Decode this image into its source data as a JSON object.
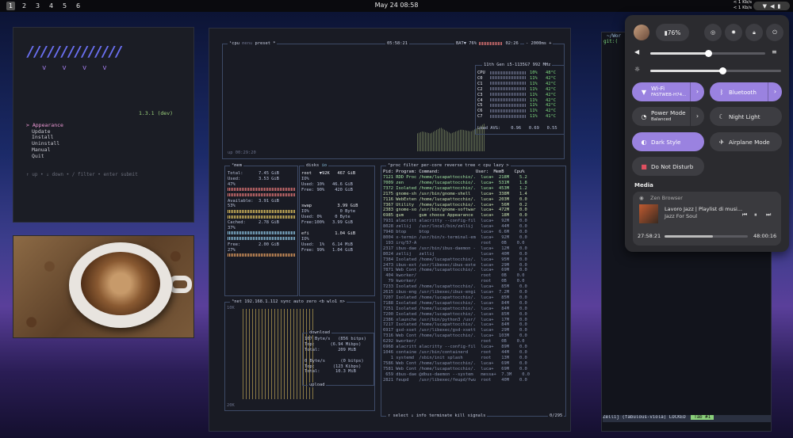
{
  "topbar": {
    "workspaces": [
      "1",
      "2",
      "3",
      "4",
      "5",
      "6"
    ],
    "clock": "May 24  08:58",
    "net_up": "< 1 Kb/s",
    "net_down": "< 1 Kb/s"
  },
  "gum": {
    "version": "1.3.1 (dev)",
    "menu": [
      "> Appearance",
      "Update",
      "Install",
      "Uninstall",
      "Manual",
      "Quit"
    ],
    "help": "↑ up • ↓ down • / filter • enter submit"
  },
  "btop": {
    "cpu_title": "cpu",
    "menu": "menu",
    "preset": "preset *",
    "time": "05:58:21",
    "battery": "BAT▼ 76%",
    "bat_time": "02:26",
    "interval": "- 2000ms +",
    "cpu_model": "11th Gen i5-1135G7",
    "freq": "992 MHz",
    "cores": [
      {
        "n": "CPU",
        "p": "10%",
        "t": "48°C"
      },
      {
        "n": "C0",
        "p": "11%",
        "t": "42°C"
      },
      {
        "n": "C1",
        "p": "11%",
        "t": "42°C"
      },
      {
        "n": "C2",
        "p": "11%",
        "t": "42°C"
      },
      {
        "n": "C3",
        "p": "11%",
        "t": "42°C"
      },
      {
        "n": "C4",
        "p": "11%",
        "t": "42°C"
      },
      {
        "n": "C5",
        "p": "11%",
        "t": "42°C"
      },
      {
        "n": "C6",
        "p": "11%",
        "t": "42°C"
      },
      {
        "n": "C7",
        "p": "11%",
        "t": "41°C"
      }
    ],
    "load": "Load AVG:    0.96   0.69   0.55",
    "uptime": "up 00:29:20",
    "mem": {
      "total": "7.45 GiB",
      "used": "3.53 GiB",
      "used_p": "47%",
      "available": "3.91 GiB",
      "avail_p": "53%",
      "cached": "2.78 GiB",
      "cached_p": "37%",
      "free": "2.00 GiB",
      "free_p": "27%"
    },
    "disks": {
      "root_hdr": "root   ▼92K   467 GiB",
      "root_io": "IO%",
      "root_used": "Used: 10%   46.6 GiB",
      "root_free": "Free: 90%    420 GiB",
      "swap_hdr": "swap          3.99 GiB",
      "swap_io": "IO%            0 Byte",
      "swap_used": "Used: 0%     0 Byte",
      "swap_free": "Free:100%   3.99 GiB",
      "efi_hdr": "efi          1.04 GiB",
      "efi_io": "IO%",
      "efi_used": "Used:  1%   6.14 MiB",
      "efi_free": "Free: 99%   1.04 GiB"
    },
    "net": {
      "title": "net",
      "ip": "192.168.1.112",
      "sync": "sync",
      "auto": "auto",
      "zero": "zero",
      "iface": "<b wlo1 n>",
      "scale_top": "10K",
      "scale_bot": "20K",
      "download": "download",
      "dl_rate": "107 Byte/s   (856 bitps)",
      "dl_top": "Top:      (6.94 Mibps)",
      "dl_total": "Total:       209 MiB",
      "ul_rate": "0 Byte/s      (0 bitps)",
      "ul_top": "Top:       (123 Kibps)",
      "ul_total": "Total:      10.3 MiB",
      "upload": "upload"
    },
    "proc": {
      "title": "proc",
      "filter": "filter",
      "per_core": "per-core",
      "reverse": "reverse",
      "tree": "tree",
      "sort": "< cpu lazy >",
      "header": "Pid: Program: Command:              User:  MemB    Cpu%",
      "rows": [
        "7121 RDD Proc /home/lucapattocchio/.  luca+  218M    5.2",
        "7009 zen      /home/lucapattocchio/.  luca+  531M    1.8",
        "7372 Isolated /home/lucapattocchio/.  luca+  453M    1.2",
        "2175 gnome-sh /usr/bin/gnome-shell    luca+  338M    1.4",
        "7116 WebExten /home/lucapattocchio/.  luca+  203M    0.0",
        "7367 Utility  /home/lucapattocchio/.  luca+   56M    0.2",
        "2383 gnome-so /usr/bin/gnome-softwar  luca+  472M    0.0",
        "6985 gum      gum choose Appearance   luca+   18M    0.0",
        "7931 alacritt alacritty --config-fil  luca+   92M    0.0",
        "8028 zellij   /usr/local/bin/zellij   luca+   44M    0.0",
        "7948 btop     btop                    luca+  6.6M    0.0",
        "8004 x-termin /usr/bin/x-terminal-em  luca+   92M    0.0",
        " 193 irq/57-A                         root    0B    0.0",
        "2317 ibus-dae /usr/bin/ibus-daemon -  luca+   12M    0.0",
        "8024 zellij   zellij                  luca+   40M    0.0",
        "7384 Isolated /home/lucapattocchio/.  luca+   95M    0.0",
        "2473 ibus-ext /usr/libexec/ibus-exte  luca+   29M    0.0",
        "7871 Web Cont /home/lucapattocchio/.  luca+   69M    0.0",
        " 404 kworker/                         root    0B    0.0",
        "  79 kworker/                         root    0B    0.0",
        "7233 Isolated /home/lucapattocchio/.  luca+   85M    0.0",
        "2615 ibus-eng /usr/libexec/ibus-engi  luca+  7.2M    0.0",
        "7207 Isolated /home/lucapattocchio/.  luca+   85M    0.0",
        "7188 Isolated /home/lucapattocchio/.  luca+   84M    0.0",
        "7251 Isolated /home/lucapattocchio/.  luca+   84M    0.0",
        "7200 Isolated /home/lucapattocchio/.  luca+   85M    0.0",
        "2386 xlaunche /usr/bin/python3 /usr/  luca+   17M    0.0",
        "7217 Isolated /home/lucapattocchio/.  luca+   84M    0.0",
        "6917 gsd-xset /usr/libexec/gsd-xsett  luca+   29M    0.0",
        "7316 Web Cont /home/lucapattocchio/.  luca+  103M    0.0",
        "6292 kworker/                         root    0B    0.0",
        "6968 alacritt alacritty --config-fil  luca+   89M    0.0",
        "1046 containe /usr/bin/containerd     root    44M    0.0",
        "   1 systemd  /sbin/init splash       root    13M    0.0",
        "7586 Web Cont /home/lucapattocchio/.  luca+   69M    0.0",
        "7581 Web Cont /home/lucapattocchio/.  luca+   69M    0.0",
        " 659 dbus-dae @dbus-daemon --system   messa+  7.3M    0.0",
        "2821 feupd    /usr/libexec/feupd/fwu  root    40M    0.0"
      ],
      "footer": "↑ select ↓  info   terminate  kill   signals",
      "count": "0/295"
    }
  },
  "terminal": {
    "path": "~/Wor",
    "git": "git:(",
    "status": "Zellij (fabulous-viola)  LOCKED",
    "tab": "Tab #1"
  },
  "qs": {
    "battery": "76%",
    "wifi": "Wi-Fi",
    "wifi_sub": "FASTWEB-H74...",
    "bluetooth": "Bluetooth",
    "power": "Power Mode",
    "power_sub": "Balanced",
    "night": "Night Light",
    "dark": "Dark Style",
    "airplane": "Airplane Mode",
    "dnd": "Do Not Disturb",
    "media_label": "Media",
    "browser": "Zen Browser",
    "track": "Lavoro Jazz | Playlist di musi...",
    "artist": "Jazz For Soul",
    "elapsed": "27:58:21",
    "duration": "48:00:16",
    "volume": 0.5,
    "brightness": 0.55,
    "progress": 0.58,
    "accent": "#9a82e0"
  }
}
